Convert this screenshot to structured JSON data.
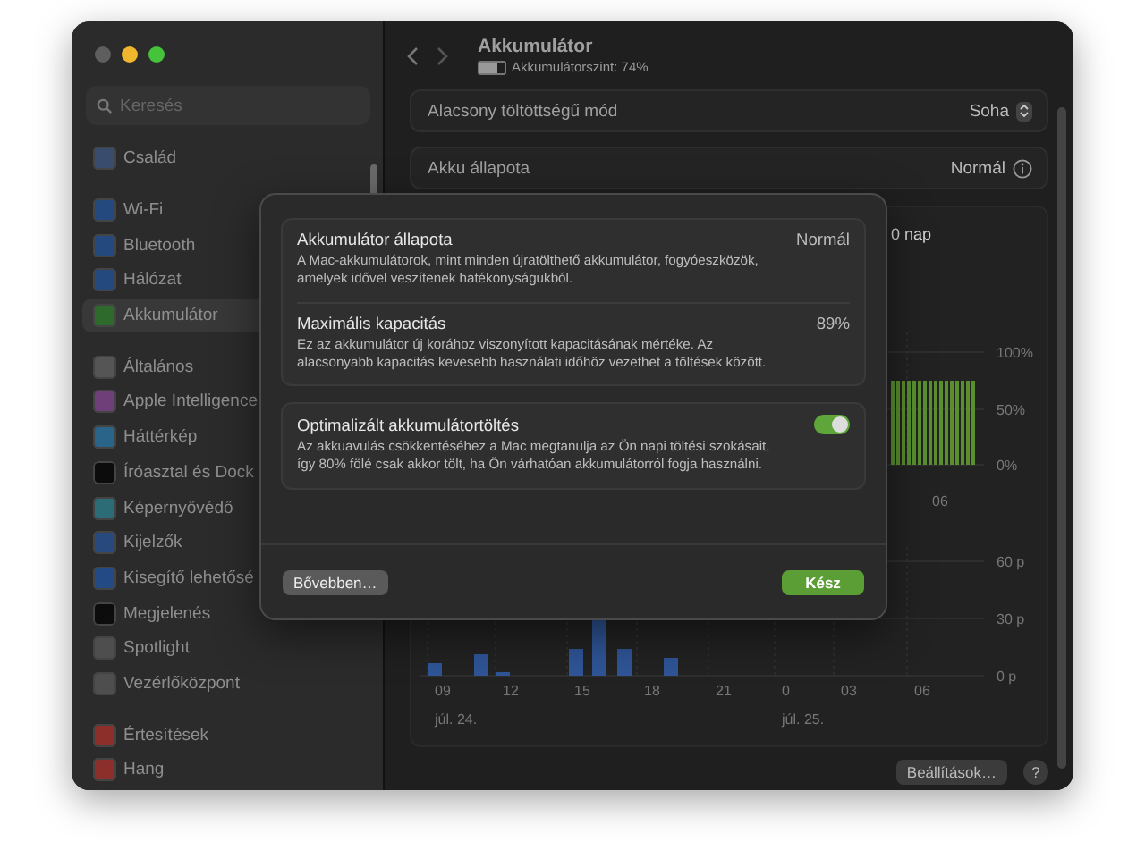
{
  "window": {
    "controls": [
      {
        "color": "#5e5e5e"
      },
      {
        "color": "#f0b62e"
      },
      {
        "color": "#45c33b"
      }
    ]
  },
  "sidebar": {
    "search": {
      "placeholder": "Keresés"
    },
    "sections": [
      {
        "items": [
          {
            "label": "Család",
            "color": "#3a4c6e",
            "selected": false
          }
        ]
      },
      {
        "items": [
          {
            "label": "Wi-Fi",
            "color": "#24497e",
            "selected": false
          },
          {
            "label": "Bluetooth",
            "color": "#24497e",
            "selected": false
          },
          {
            "label": "Hálózat",
            "color": "#24497e",
            "selected": false
          },
          {
            "label": "Akkumulátor",
            "color": "#2e6a2c",
            "selected": true
          }
        ]
      },
      {
        "items": [
          {
            "label": "Általános",
            "color": "#555555",
            "selected": false
          },
          {
            "label": "Apple Intelligence",
            "color": "#6e3f78",
            "selected": false
          },
          {
            "label": "Háttérkép",
            "color": "#2a6488",
            "selected": false
          },
          {
            "label": "Íróasztal és Dock",
            "color": "#0c0c0c",
            "selected": false
          },
          {
            "label": "Képernyővédő",
            "color": "#2c6c76",
            "selected": false
          },
          {
            "label": "Kijelzők",
            "color": "#27497e",
            "selected": false
          },
          {
            "label": "Kisegítő lehetősé",
            "color": "#244a86",
            "selected": false
          },
          {
            "label": "Megjelenés",
            "color": "#0c0c0c",
            "selected": false
          },
          {
            "label": "Spotlight",
            "color": "#4e4e4e",
            "selected": false
          },
          {
            "label": "Vezérlőközpont",
            "color": "#4e4e4e",
            "selected": false
          }
        ]
      },
      {
        "items": [
          {
            "label": "Értesítések",
            "color": "#8c2f2b",
            "selected": false
          },
          {
            "label": "Hang",
            "color": "#8c2f2b",
            "selected": false
          }
        ]
      }
    ]
  },
  "header": {
    "title": "Akkumulátor",
    "subtitle": "Akkumulátorszint: 74%",
    "battery": {
      "level": 0.74
    }
  },
  "settings_rows": [
    {
      "label": "Alacsony töltöttségű mód",
      "value": "Soha",
      "kind": "popup"
    },
    {
      "label": "Akku állapota",
      "value": "Normál",
      "kind": "info"
    }
  ],
  "usage": {
    "fragment": "0 nap",
    "level_chart": {
      "yticks": [
        "100%",
        "50%",
        "0%"
      ],
      "xticks": [
        "06"
      ]
    },
    "activity_chart": {
      "yticks": [
        "60 p",
        "30 p",
        "0 p"
      ],
      "xticks": [
        "09",
        "12",
        "15",
        "18",
        "21",
        "0",
        "03",
        "06"
      ],
      "dates": [
        "júl. 24.",
        "júl. 25."
      ]
    }
  },
  "footer_buttons": [
    {
      "label": "Beállítások…",
      "kind": "text"
    },
    {
      "label": "?",
      "kind": "help"
    }
  ],
  "sheet": {
    "sections": [
      {
        "rows": [
          {
            "kind": "value",
            "title": "Akkumulátor állapota",
            "value": "Normál",
            "description": "A Mac-akkumulátorok, mint minden újratölthető akkumulátor, fogyóeszközök, amelyek idővel veszítenek hatékonyságukból."
          },
          {
            "kind": "value",
            "title": "Maximális kapacitás",
            "value": "89%",
            "description": "Ez az akkumulátor új korához viszonyított kapacitásának mértéke. Az alacsonyabb kapacitás kevesebb használati időhöz vezethet a töltések között."
          }
        ]
      },
      {
        "rows": [
          {
            "kind": "toggle",
            "title": "Optimalizált akkumulátortöltés",
            "on": true,
            "description": "Az akkuavulás csökkentéséhez a Mac megtanulja az Ön napi töltési szokásait, így 80% fölé csak akkor tölt, ha Ön várhatóan akkumulátorról fogja használni."
          }
        ]
      }
    ],
    "buttons": [
      {
        "label": "Bővebben…",
        "kind": "secondary"
      },
      {
        "label": "Kész",
        "kind": "primary"
      }
    ]
  }
}
